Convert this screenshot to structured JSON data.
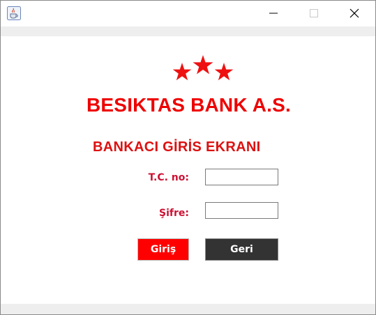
{
  "window": {
    "app_icon": "java-cup-icon",
    "controls": [
      "minimize-icon",
      "maximize-icon",
      "close-icon"
    ]
  },
  "brand": {
    "logo": "three-red-stars",
    "name": "BESIKTAS BANK A.S."
  },
  "screen": {
    "title": "BANKACI GİRİS EKRANI"
  },
  "form": {
    "tc_label": "T.C. no:",
    "tc_value": "",
    "sifre_label": "Şifre:",
    "sifre_value": ""
  },
  "buttons": {
    "giris_label": "Giriş",
    "geri_label": "Geri"
  },
  "colors": {
    "accent_red": "#ff0000",
    "title_red": "#ee0000",
    "label_red": "#cc1133",
    "dark_button": "#333333"
  }
}
